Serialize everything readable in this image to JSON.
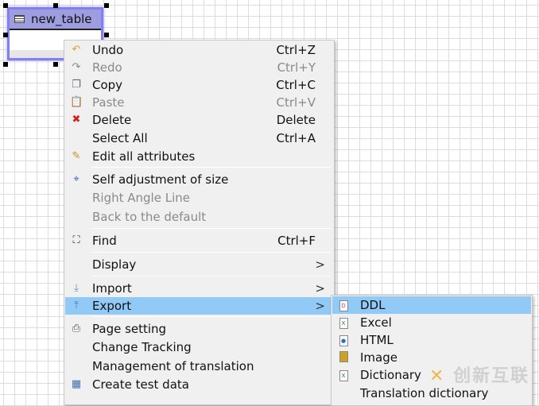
{
  "table": {
    "name": "new_table",
    "icon": "table-icon"
  },
  "context_menu": {
    "items": [
      {
        "label": "Undo",
        "shortcut": "Ctrl+Z",
        "icon": "undo-icon",
        "enabled": true
      },
      {
        "label": "Redo",
        "shortcut": "Ctrl+Y",
        "icon": "redo-icon",
        "enabled": false
      },
      {
        "label": "Copy",
        "shortcut": "Ctrl+C",
        "icon": "copy-icon",
        "enabled": true
      },
      {
        "label": "Paste",
        "shortcut": "Ctrl+V",
        "icon": "paste-icon",
        "enabled": false
      },
      {
        "label": "Delete",
        "shortcut": "Delete",
        "icon": "delete-icon",
        "enabled": true
      },
      {
        "label": "Select All",
        "shortcut": "Ctrl+A",
        "enabled": true
      },
      {
        "label": "Edit all attributes",
        "icon": "pencil-icon",
        "enabled": true
      },
      {
        "label": "Self adjustment of size",
        "icon": "resize-icon",
        "enabled": true
      },
      {
        "label": "Right Angle Line",
        "enabled": false
      },
      {
        "label": "Back to the default",
        "enabled": false
      },
      {
        "label": "Find",
        "shortcut": "Ctrl+F",
        "icon": "binoculars-icon",
        "enabled": true
      },
      {
        "label": "Display",
        "submenu": ">",
        "enabled": true
      },
      {
        "label": "Import",
        "submenu": ">",
        "icon": "import-icon",
        "enabled": true
      },
      {
        "label": "Export",
        "submenu": ">",
        "icon": "export-icon",
        "enabled": true,
        "highlighted": true
      },
      {
        "label": "Page setting",
        "icon": "printer-icon",
        "enabled": true
      },
      {
        "label": "Change Tracking",
        "enabled": true
      },
      {
        "label": "Management of translation",
        "enabled": true
      },
      {
        "label": "Create test data",
        "icon": "test-data-icon",
        "enabled": true
      }
    ]
  },
  "export_submenu": {
    "items": [
      {
        "label": "DDL",
        "icon": "ddl-file-icon",
        "highlighted": true
      },
      {
        "label": "Excel",
        "icon": "excel-file-icon"
      },
      {
        "label": "HTML",
        "icon": "html-file-icon"
      },
      {
        "label": "Image",
        "icon": "image-file-icon"
      },
      {
        "label": "Dictionary",
        "icon": "dictionary-file-icon"
      },
      {
        "label": "Translation dictionary"
      }
    ]
  },
  "watermark": "创新互联",
  "colors": {
    "highlight": "#91c9f7",
    "table_header": "#9d9de0",
    "selection_border": "#8080f0"
  }
}
